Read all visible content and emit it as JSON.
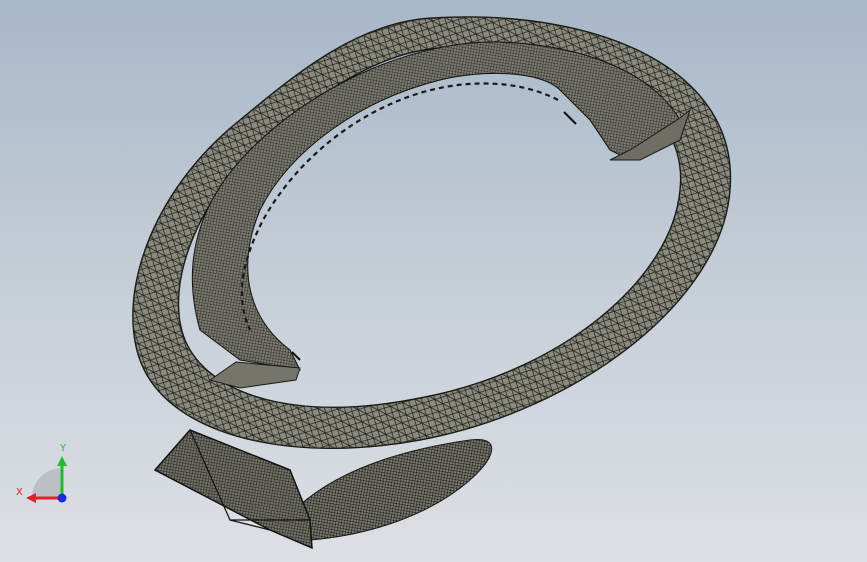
{
  "viewport": {
    "background_top": "#a8b7c9",
    "background_bottom": "#dde0e5"
  },
  "model": {
    "body_color": "#8a8a7e",
    "wire_color": "#1a1a18"
  },
  "triad": {
    "x_label": "X",
    "y_label": "Y",
    "x_color": "#e0202a",
    "y_color": "#28b832",
    "z_color": "#1e2ad8"
  }
}
